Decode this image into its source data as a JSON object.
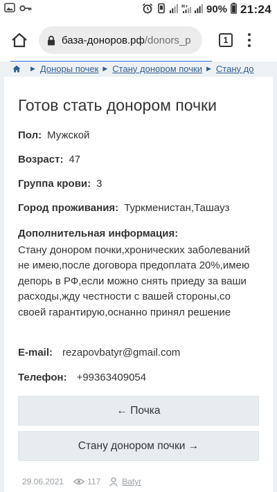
{
  "status_bar": {
    "battery": "90%",
    "time": "21:24",
    "icons": [
      "photo-icon",
      "key-icon",
      "alarm-icon",
      "vibrate-icon",
      "signal-icon",
      "signal-h-icon",
      "signal-icon",
      "battery-icon"
    ]
  },
  "browser": {
    "url_host": "база-доноров.рф",
    "url_path": "/donors_p",
    "tab_count": "1"
  },
  "breadcrumbs": [
    "Доноры почек",
    "Стану донором почки",
    "Стану до"
  ],
  "page": {
    "title": "Готов стать донором почки",
    "fields": {
      "gender_label": "Пол:",
      "gender_value": "Мужской",
      "age_label": "Возраст:",
      "age_value": "47",
      "blood_label": "Группа крови:",
      "blood_value": "3",
      "city_label": "Город проживания:",
      "city_value": "Туркменистан,Ташауз",
      "info_label": "Дополнительная информация:",
      "info_text": "Стану донором почки,хронических заболеваний не имею,после договора предоплата 20%,имею депорь в РФ,если можно снять приеду за ваши расходы,жду честности с вашей стороны,со своей гарантирую,оснанно принял решение",
      "email_label": "E-mail:",
      "email_value": "rezapovbatyr@gmail.com",
      "phone_label": "Телефон:",
      "phone_value": "+99363409054"
    },
    "prev_button": "← Почка",
    "next_button": "Стану донором почки →",
    "footer": {
      "date": "29.06.2021",
      "views": "117",
      "author": "Batyr"
    }
  },
  "colors": {
    "link": "#2f5f8f",
    "progress": "#2a6dd8",
    "page_bg": "#eef1f4",
    "button_bg": "#e7ecef"
  }
}
